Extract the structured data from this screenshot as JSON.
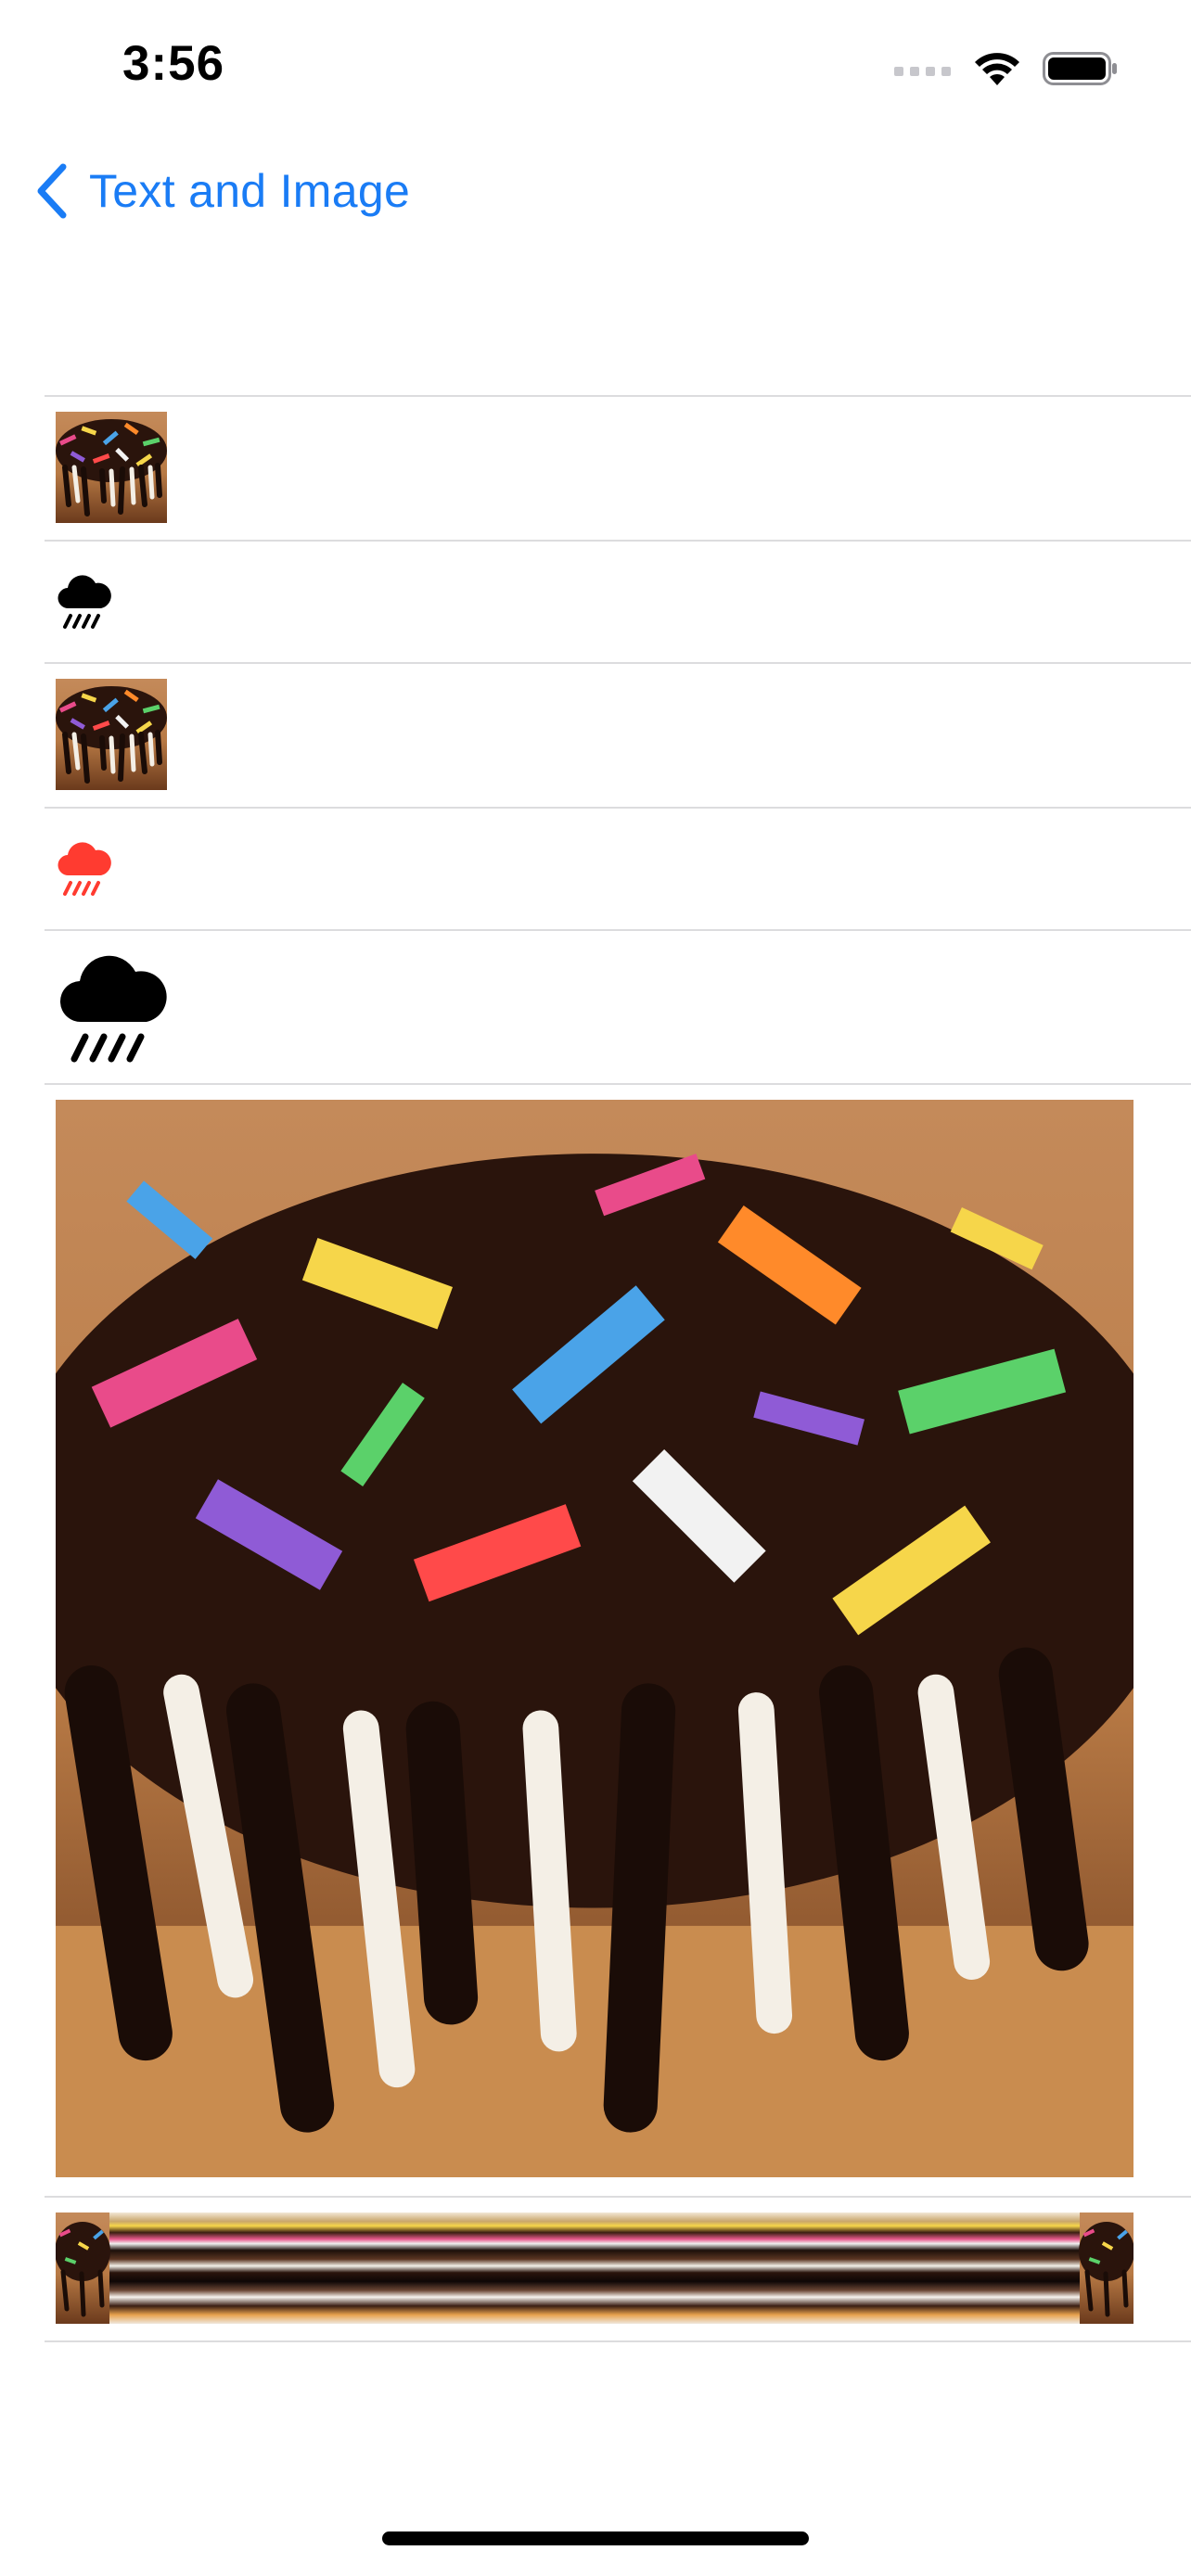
{
  "status_bar": {
    "time": "3:56"
  },
  "nav": {
    "back_label": "Text and Image",
    "back_icon": "chevron-left-icon"
  },
  "rows": [
    {
      "kind": "image",
      "icon": "donut-image",
      "size": "small"
    },
    {
      "kind": "symbol",
      "icon": "cloud-rain-icon",
      "size": "small",
      "color": "#000000"
    },
    {
      "kind": "image",
      "icon": "donut-image",
      "size": "small"
    },
    {
      "kind": "symbol",
      "icon": "cloud-rain-icon",
      "size": "small",
      "color": "#ff3b30"
    },
    {
      "kind": "symbol",
      "icon": "cloud-rain-icon",
      "size": "large",
      "color": "#000000"
    },
    {
      "kind": "image",
      "icon": "donut-image",
      "size": "large"
    },
    {
      "kind": "image",
      "icon": "donut-image",
      "size": "stretched"
    }
  ],
  "colors": {
    "accent": "#1a7cf5",
    "separator": "#dcdcde",
    "rain_red": "#ff3b30"
  }
}
